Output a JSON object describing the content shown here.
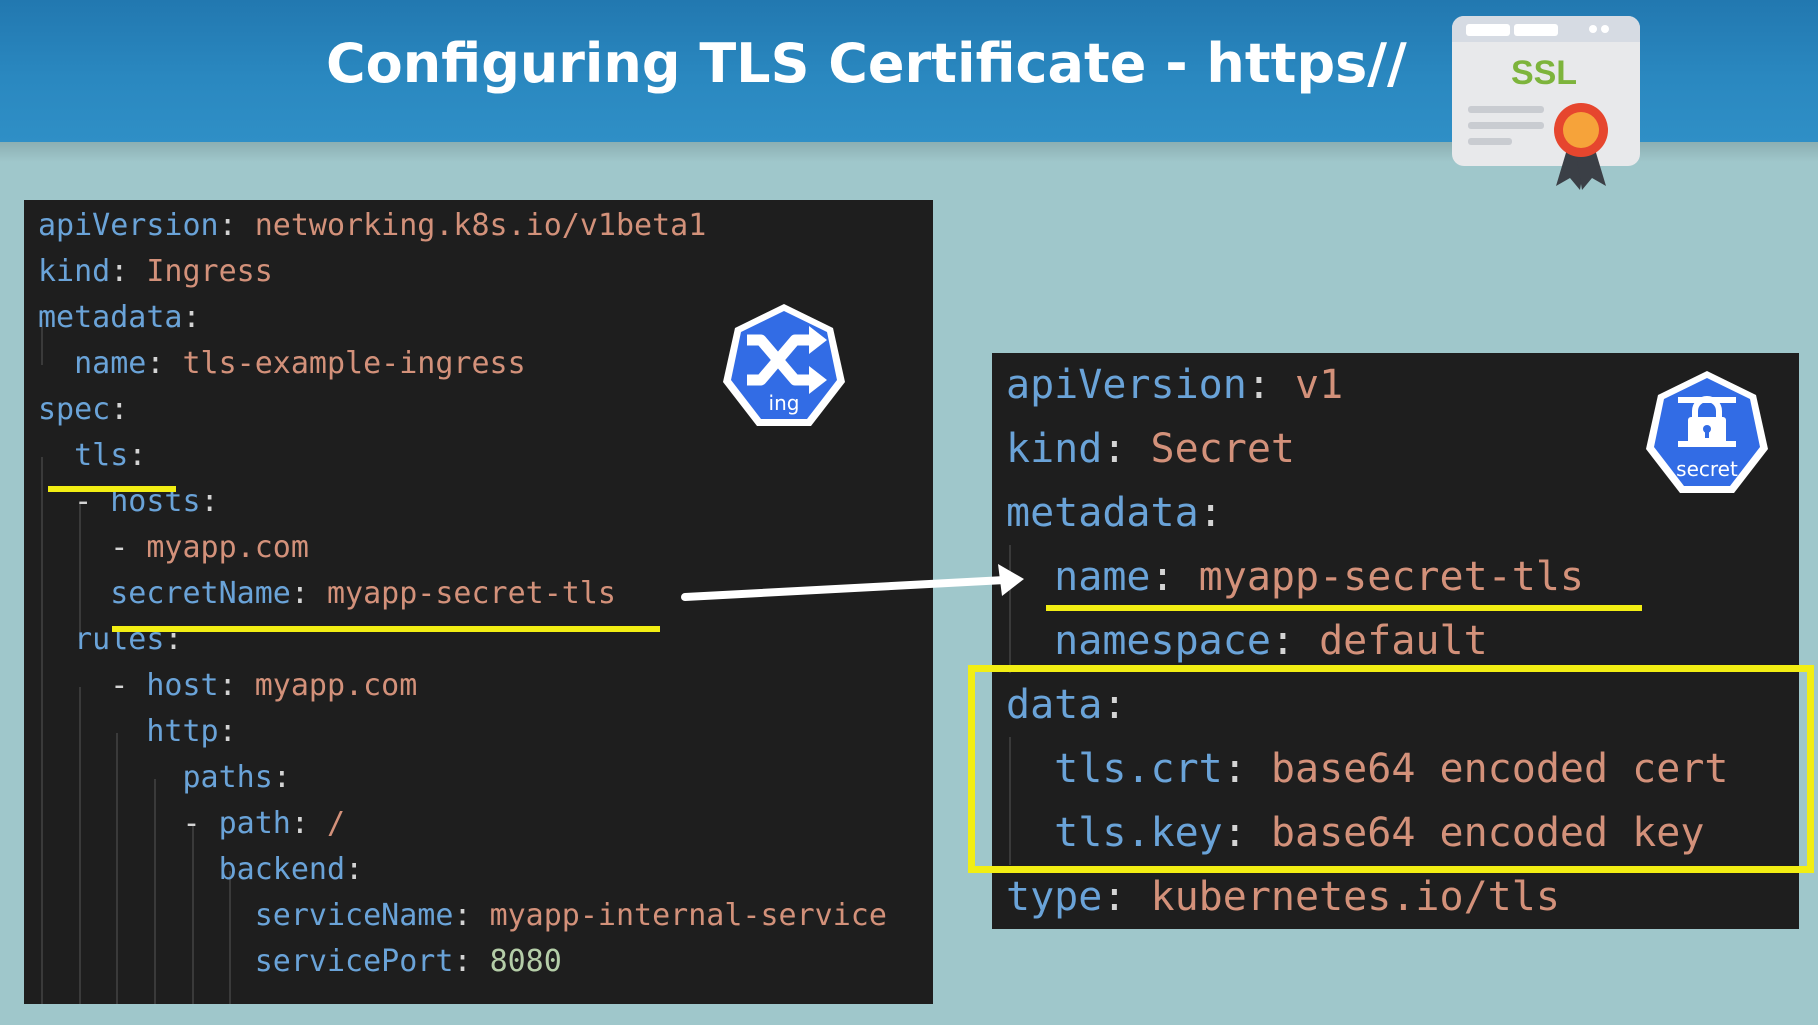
{
  "header": {
    "title": "Configuring TLS Certificate - https//"
  },
  "ssl_badge": {
    "label": "SSL"
  },
  "ingress": {
    "badge_label": "ing",
    "lines": [
      [
        {
          "t": "apiVersion",
          "c": "k"
        },
        {
          "t": ": ",
          "c": "p"
        },
        {
          "t": "networking.k8s.io/v1beta1",
          "c": "v"
        }
      ],
      [
        {
          "t": "kind",
          "c": "k"
        },
        {
          "t": ": ",
          "c": "p"
        },
        {
          "t": "Ingress",
          "c": "v"
        }
      ],
      [
        {
          "t": "metadata",
          "c": "k"
        },
        {
          "t": ":",
          "c": "p"
        }
      ],
      [
        {
          "t": "  ",
          "c": "p"
        },
        {
          "t": "name",
          "c": "k"
        },
        {
          "t": ": ",
          "c": "p"
        },
        {
          "t": "tls-example-ingress",
          "c": "v"
        }
      ],
      [
        {
          "t": "spec",
          "c": "k"
        },
        {
          "t": ":",
          "c": "p"
        }
      ],
      [
        {
          "t": "  ",
          "c": "p"
        },
        {
          "t": "tls",
          "c": "k"
        },
        {
          "t": ":",
          "c": "p"
        }
      ],
      [
        {
          "t": "  - ",
          "c": "p"
        },
        {
          "t": "hosts",
          "c": "k"
        },
        {
          "t": ":",
          "c": "p"
        }
      ],
      [
        {
          "t": "    - ",
          "c": "p"
        },
        {
          "t": "myapp.com",
          "c": "v"
        }
      ],
      [
        {
          "t": "    ",
          "c": "p"
        },
        {
          "t": "secretName",
          "c": "k"
        },
        {
          "t": ": ",
          "c": "p"
        },
        {
          "t": "myapp-secret-tls",
          "c": "v"
        }
      ],
      [
        {
          "t": "  ",
          "c": "p"
        },
        {
          "t": "rules",
          "c": "k"
        },
        {
          "t": ":",
          "c": "p"
        }
      ],
      [
        {
          "t": "    - ",
          "c": "p"
        },
        {
          "t": "host",
          "c": "k"
        },
        {
          "t": ": ",
          "c": "p"
        },
        {
          "t": "myapp.com",
          "c": "v"
        }
      ],
      [
        {
          "t": "      ",
          "c": "p"
        },
        {
          "t": "http",
          "c": "k"
        },
        {
          "t": ":",
          "c": "p"
        }
      ],
      [
        {
          "t": "        ",
          "c": "p"
        },
        {
          "t": "paths",
          "c": "k"
        },
        {
          "t": ":",
          "c": "p"
        }
      ],
      [
        {
          "t": "        - ",
          "c": "p"
        },
        {
          "t": "path",
          "c": "k"
        },
        {
          "t": ": ",
          "c": "p"
        },
        {
          "t": "/",
          "c": "v"
        }
      ],
      [
        {
          "t": "          ",
          "c": "p"
        },
        {
          "t": "backend",
          "c": "k"
        },
        {
          "t": ":",
          "c": "p"
        }
      ],
      [
        {
          "t": "            ",
          "c": "p"
        },
        {
          "t": "serviceName",
          "c": "k"
        },
        {
          "t": ": ",
          "c": "p"
        },
        {
          "t": "myapp-internal-service",
          "c": "v"
        }
      ],
      [
        {
          "t": "            ",
          "c": "p"
        },
        {
          "t": "servicePort",
          "c": "k"
        },
        {
          "t": ": ",
          "c": "p"
        },
        {
          "t": "8080",
          "c": "n"
        }
      ]
    ]
  },
  "secret": {
    "badge_label": "secret",
    "lines": [
      [
        {
          "t": "apiVersion",
          "c": "k"
        },
        {
          "t": ": ",
          "c": "p"
        },
        {
          "t": "v1",
          "c": "v"
        }
      ],
      [
        {
          "t": "kind",
          "c": "k"
        },
        {
          "t": ": ",
          "c": "p"
        },
        {
          "t": "Secret",
          "c": "v"
        }
      ],
      [
        {
          "t": "metadata",
          "c": "k"
        },
        {
          "t": ":",
          "c": "p"
        }
      ],
      [
        {
          "t": "  ",
          "c": "p"
        },
        {
          "t": "name",
          "c": "k"
        },
        {
          "t": ": ",
          "c": "p"
        },
        {
          "t": "myapp-secret-tls",
          "c": "v"
        }
      ],
      [
        {
          "t": "  ",
          "c": "p"
        },
        {
          "t": "namespace",
          "c": "k"
        },
        {
          "t": ": ",
          "c": "p"
        },
        {
          "t": "default",
          "c": "v"
        }
      ],
      [
        {
          "t": "data",
          "c": "k"
        },
        {
          "t": ":",
          "c": "p"
        }
      ],
      [
        {
          "t": "  ",
          "c": "p"
        },
        {
          "t": "tls.crt",
          "c": "k"
        },
        {
          "t": ": ",
          "c": "p"
        },
        {
          "t": "base64 encoded cert",
          "c": "v"
        }
      ],
      [
        {
          "t": "  ",
          "c": "p"
        },
        {
          "t": "tls.key",
          "c": "k"
        },
        {
          "t": ": ",
          "c": "p"
        },
        {
          "t": "base64 encoded key",
          "c": "v"
        }
      ],
      [
        {
          "t": "type",
          "c": "k"
        },
        {
          "t": ": ",
          "c": "p"
        },
        {
          "t": "kubernetes.io/tls",
          "c": "v"
        }
      ]
    ]
  },
  "colors": {
    "key": "#6aa3d8",
    "value": "#d3917a",
    "number": "#b5cea8",
    "punct": "#d4d4d4",
    "highlight": "#f2ee13",
    "k8s_blue": "#326ce5"
  }
}
